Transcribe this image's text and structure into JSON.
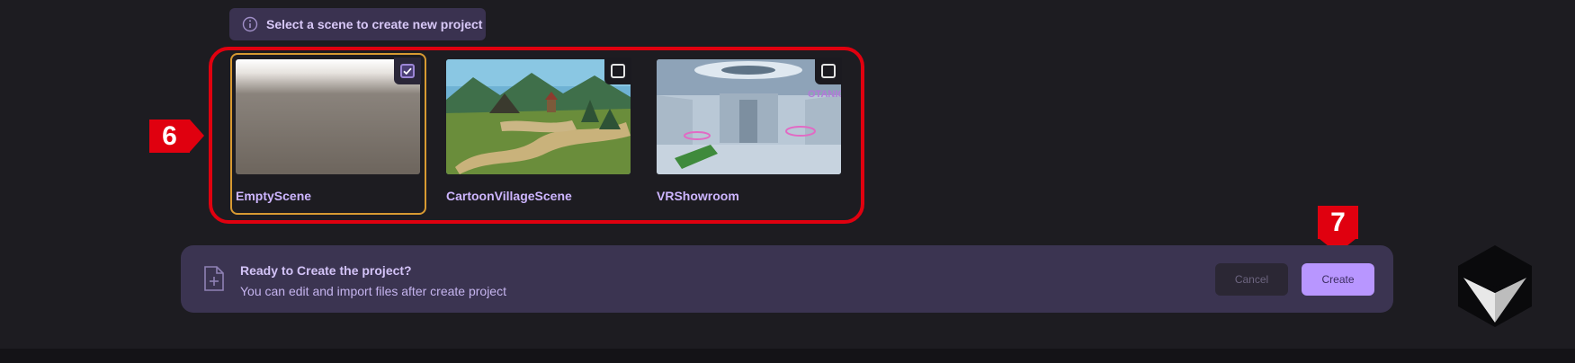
{
  "banner": {
    "text": "Select a scene to create new project",
    "icon": "info-icon"
  },
  "scenes": [
    {
      "label": "EmptyScene",
      "selected": true
    },
    {
      "label": "CartoonVillageScene",
      "selected": false
    },
    {
      "label": "VRShowroom",
      "selected": false
    }
  ],
  "markers": {
    "step_a": "6",
    "step_b": "7"
  },
  "footer": {
    "title": "Ready to Create the project?",
    "subtitle": "You can edit and import files after create project",
    "icon": "file-plus-icon",
    "cancel_label": "Cancel",
    "create_label": "Create"
  },
  "colors": {
    "background": "#1d1c21",
    "accent": "#b896ff",
    "highlight": "#e0000f",
    "selected_border": "#d89a32",
    "footer_bg": "#3b3451"
  }
}
